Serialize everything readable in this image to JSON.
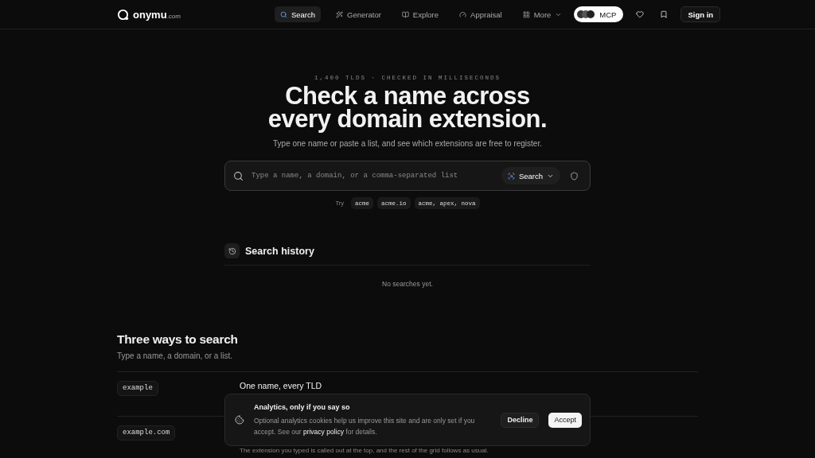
{
  "header": {
    "logo": "onymu",
    "logo_suffix": ".com",
    "nav": [
      {
        "label": "Search",
        "selected": true
      },
      {
        "label": "Generator",
        "selected": false
      },
      {
        "label": "Explore",
        "selected": false
      },
      {
        "label": "Appraisal",
        "selected": false
      },
      {
        "label": "More",
        "selected": false
      }
    ],
    "mcp": "MCP",
    "sign_in": "Sign in"
  },
  "hero": {
    "eyebrow": "1,400 TLDS · CHECKED IN MILLISECONDS",
    "title_lines": [
      "Check a name across",
      "every domain extension."
    ],
    "subtitle": "Type one name or paste a list, and see which extensions are free to register.",
    "search": {
      "placeholder": "Type a name, a domain, or a comma-separated list",
      "mode": "Search"
    },
    "try_label": "Try",
    "examples": [
      "acme",
      "acme.io",
      "acme, apex, nova"
    ]
  },
  "history": {
    "title": "Search history",
    "empty": "No searches yet."
  },
  "ways": {
    "title": "Three ways to search",
    "subtitle": "Type a name, a domain, or a list.",
    "rows": [
      {
        "example": "example",
        "title": "One name, every TLD"
      },
      {
        "example": "example.com",
        "description": "The extension you typed is called out at the top, and the rest of the grid follows as usual."
      }
    ]
  },
  "cookie": {
    "title": "Analytics, only if you say so",
    "text_before": "Optional analytics cookies help us improve this site and are only set if you accept. See our ",
    "link": "privacy policy",
    "text_after": " for details.",
    "decline": "Decline",
    "accept": "Accept"
  }
}
